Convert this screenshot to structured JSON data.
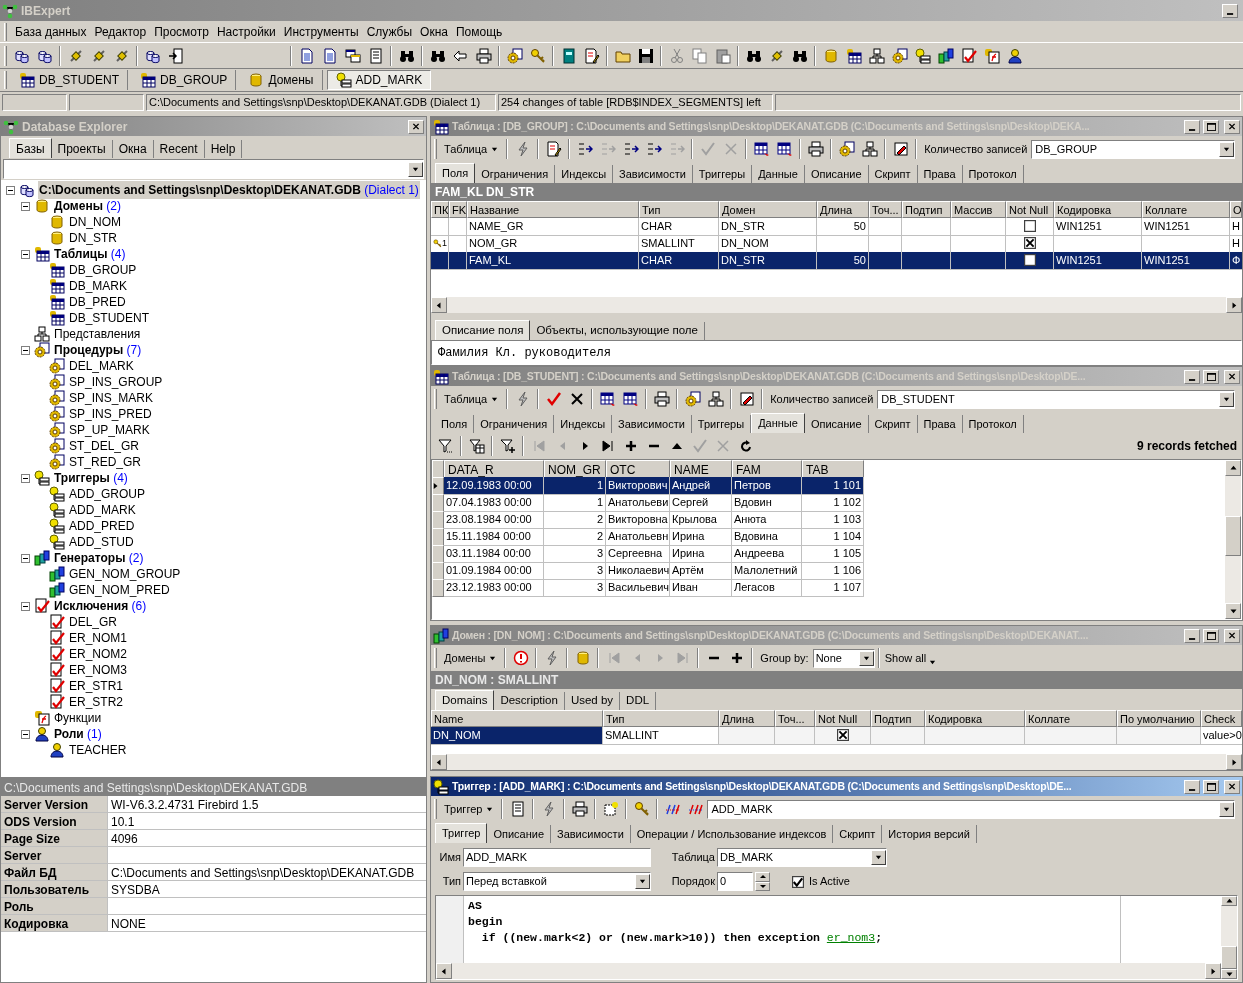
{
  "app": {
    "title": "IBExpert"
  },
  "menu": [
    "База данных",
    "Редактор",
    "Просмотр",
    "Настройки",
    "Инструменты",
    "Службы",
    "Окна",
    "Помощь"
  ],
  "window_tabs": [
    {
      "label": "DB_STUDENT",
      "kind": "table",
      "selected": false
    },
    {
      "label": "DB_GROUP",
      "kind": "table",
      "selected": false
    },
    {
      "label": "Домены",
      "kind": "domain",
      "selected": false
    },
    {
      "label": "ADD_MARK",
      "kind": "trigger",
      "selected": true
    }
  ],
  "status_bar": [
    "C:\\Documents and Settings\\snp\\Desktop\\DEKANAT.GDB (Dialect 1)",
    "254 changes of table [RDB$INDEX_SEGMENTS] left"
  ],
  "explorer": {
    "title": "Database Explorer",
    "tabs": [
      {
        "label": "Базы",
        "selected": true
      },
      {
        "label": "Проекты",
        "selected": false
      },
      {
        "label": "Окна",
        "selected": false
      },
      {
        "label": "Recent",
        "selected": false
      },
      {
        "label": "Help",
        "selected": false
      }
    ],
    "tree": [
      {
        "label": "C:\\Documents and Settings\\snp\\Desktop\\DEKANAT.GDB",
        "count": "(Dialect 1)",
        "kind": "database",
        "expanded": true,
        "selected": true,
        "children": [
          {
            "label": "Домены",
            "count": "(2)",
            "kind": "domain",
            "expanded": true,
            "selected": false,
            "children": [
              {
                "label": "DN_NOM",
                "kind": "domain",
                "selected": false
              },
              {
                "label": "DN_STR",
                "kind": "domain",
                "selected": false
              }
            ]
          },
          {
            "label": "Таблицы",
            "count": "(4)",
            "kind": "table",
            "expanded": true,
            "selected": false,
            "children": [
              {
                "label": "DB_GROUP",
                "kind": "table",
                "selected": false
              },
              {
                "label": "DB_MARK",
                "kind": "table",
                "selected": false
              },
              {
                "label": "DB_PRED",
                "kind": "table",
                "selected": false
              },
              {
                "label": "DB_STUDENT",
                "kind": "table",
                "selected": false
              }
            ]
          },
          {
            "label": "Представления",
            "kind": "view",
            "selected": false
          },
          {
            "label": "Процедуры",
            "count": "(7)",
            "kind": "procedure",
            "expanded": true,
            "selected": false,
            "children": [
              {
                "label": "DEL_MARK",
                "kind": "procedure",
                "selected": false
              },
              {
                "label": "SP_INS_GROUP",
                "kind": "procedure",
                "selected": false
              },
              {
                "label": "SP_INS_MARK",
                "kind": "procedure",
                "selected": false
              },
              {
                "label": "SP_INS_PRED",
                "kind": "procedure",
                "selected": false
              },
              {
                "label": "SP_UP_MARK",
                "kind": "procedure",
                "selected": false
              },
              {
                "label": "ST_DEL_GR",
                "kind": "procedure",
                "selected": false
              },
              {
                "label": "ST_RED_GR",
                "kind": "procedure",
                "selected": false
              }
            ]
          },
          {
            "label": "Триггеры",
            "count": "(4)",
            "kind": "trigger",
            "expanded": true,
            "selected": false,
            "children": [
              {
                "label": "ADD_GROUP",
                "kind": "trigger",
                "selected": false
              },
              {
                "label": "ADD_MARK",
                "kind": "trigger",
                "selected": false
              },
              {
                "label": "ADD_PRED",
                "kind": "trigger",
                "selected": false
              },
              {
                "label": "ADD_STUD",
                "kind": "trigger",
                "selected": false
              }
            ]
          },
          {
            "label": "Генераторы",
            "count": "(2)",
            "kind": "generator",
            "expanded": true,
            "selected": false,
            "children": [
              {
                "label": "GEN_NOM_GROUP",
                "kind": "generator",
                "selected": false
              },
              {
                "label": "GEN_NOM_PRED",
                "kind": "generator",
                "selected": false
              }
            ]
          },
          {
            "label": "Исключения",
            "count": "(6)",
            "kind": "exception",
            "expanded": true,
            "selected": false,
            "children": [
              {
                "label": "DEL_GR",
                "kind": "exception",
                "selected": false
              },
              {
                "label": "ER_NOM1",
                "kind": "exception",
                "selected": false
              },
              {
                "label": "ER_NOM2",
                "kind": "exception",
                "selected": false
              },
              {
                "label": "ER_NOM3",
                "kind": "exception",
                "selected": false
              },
              {
                "label": "ER_STR1",
                "kind": "exception",
                "selected": false
              },
              {
                "label": "ER_STR2",
                "kind": "exception",
                "selected": false
              }
            ]
          },
          {
            "label": "Функции",
            "kind": "function",
            "selected": false
          },
          {
            "label": "Роли",
            "count": "(1)",
            "kind": "role",
            "expanded": true,
            "selected": false,
            "children": [
              {
                "label": "TEACHER",
                "kind": "role",
                "selected": false
              }
            ]
          }
        ]
      }
    ],
    "properties": {
      "header": "C:\\Documents and Settings\\snp\\Desktop\\DEKANAT.GDB",
      "rows": [
        {
          "name": "Server Version",
          "value": "WI-V6.3.2.4731 Firebird 1.5"
        },
        {
          "name": "ODS Version",
          "value": "10.1"
        },
        {
          "name": "Page Size",
          "value": "4096"
        },
        {
          "name": "Server",
          "value": ""
        },
        {
          "name": "Файл БД",
          "value": "C:\\Documents and Settings\\snp\\Desktop\\DEKANAT.GDB"
        },
        {
          "name": "Пользователь",
          "value": "SYSDBA"
        },
        {
          "name": "Роль",
          "value": ""
        },
        {
          "name": "Кодировка",
          "value": "NONE"
        }
      ]
    }
  },
  "table_window": {
    "title": "Таблица : [DB_GROUP] : C:\\Documents and Settings\\snp\\Desktop\\DEKANAT.GDB (C:\\Documents and Settings\\snp\\Desktop\\DEKA...",
    "active": false,
    "menu_button": "Таблица",
    "records_label": "Количество записей",
    "object": "DB_GROUP",
    "tabs": [
      {
        "label": "Поля",
        "selected": true
      },
      {
        "label": "Ограничения",
        "selected": false
      },
      {
        "label": "Индексы",
        "selected": false
      },
      {
        "label": "Зависимости",
        "selected": false
      },
      {
        "label": "Триггеры",
        "selected": false
      },
      {
        "label": "Данные",
        "selected": false
      },
      {
        "label": "Описание",
        "selected": false
      },
      {
        "label": "Скрипт",
        "selected": false
      },
      {
        "label": "Права",
        "selected": false
      },
      {
        "label": "Протокол",
        "selected": false
      }
    ],
    "caption": "FAM_KL DN_STR",
    "columns": [
      "ПК",
      "FK",
      "Название",
      "Тип",
      "Домен",
      "Длина",
      "Точ...",
      "Подтип",
      "Массив",
      "Not Null",
      "Кодировка",
      "Коллате",
      "О"
    ],
    "rows": [
      {
        "name": "NAME_GR",
        "type": "CHAR",
        "domain": "DN_STR",
        "length": "50",
        "not_null": false,
        "charset": "WIN1251",
        "collate": "WIN1251",
        "column_13": "Н",
        "selected": false
      },
      {
        "key": "1",
        "name": "NOM_GR",
        "type": "SMALLINT",
        "domain": "DN_NOM",
        "not_null": true,
        "column_13": "Н",
        "selected": false
      },
      {
        "name": "FAM_KL",
        "type": "CHAR",
        "domain": "DN_STR",
        "length": "50",
        "not_null": false,
        "charset": "WIN1251",
        "collate": "WIN1251",
        "column_13": "Ф",
        "selected": true
      }
    ],
    "bottom_tabs": [
      {
        "label": "Описание поля",
        "selected": true
      },
      {
        "label": "Объекты, использующие поле",
        "selected": false
      }
    ],
    "description": "Фамилия Кл. руководителя"
  },
  "student_window": {
    "title": "Таблица : [DB_STUDENT] : C:\\Documents and Settings\\snp\\Desktop\\DEKANAT.GDB (C:\\Documents and Settings\\snp\\Desktop\\DE...",
    "active": false,
    "menu_button": "Таблица",
    "records_label": "Количество записей",
    "object": "DB_STUDENT",
    "tabs": [
      {
        "label": "Поля",
        "selected": false
      },
      {
        "label": "Ограничения",
        "selected": false
      },
      {
        "label": "Индексы",
        "selected": false
      },
      {
        "label": "Зависимости",
        "selected": false
      },
      {
        "label": "Триггеры",
        "selected": false
      },
      {
        "label": "Данные",
        "selected": true
      },
      {
        "label": "Описание",
        "selected": false
      },
      {
        "label": "Скрипт",
        "selected": false
      },
      {
        "label": "Права",
        "selected": false
      },
      {
        "label": "Протокол",
        "selected": false
      }
    ],
    "fetched": "9 records fetched",
    "columns": [
      "DATA_R",
      "NOM_GR",
      "OTC",
      "NAME",
      "FAM",
      "TAB"
    ],
    "rows": [
      {
        "cells": [
          "12.09.1983 00:00",
          "1",
          "Викторович",
          "Андрей",
          "Петров",
          "1 101"
        ],
        "selected": true
      },
      {
        "cells": [
          "07.04.1983 00:00",
          "1",
          "Анатольеви",
          "Сергей",
          "Вдовин",
          "1 102"
        ],
        "selected": false
      },
      {
        "cells": [
          "23.08.1984 00:00",
          "2",
          "Викторовна",
          "Крылова",
          "Анюта",
          "1 103"
        ],
        "selected": false
      },
      {
        "cells": [
          "15.11.1984 00:00",
          "2",
          "Анатольевн",
          "Ирина",
          "Вдовина",
          "1 104"
        ],
        "selected": false
      },
      {
        "cells": [
          "03.11.1984 00:00",
          "3",
          "Сергеевна",
          "Ирина",
          "Андреева",
          "1 105"
        ],
        "selected": false
      },
      {
        "cells": [
          "01.09.1984 00:00",
          "3",
          "Николаевич",
          "Артём",
          "Малолетний",
          "1 106"
        ],
        "selected": false
      },
      {
        "cells": [
          "23.12.1983 00:00",
          "3",
          "Васильевич",
          "Иван",
          "Легасов",
          "1 107"
        ],
        "selected": false
      }
    ]
  },
  "domain_window": {
    "title": "Домен : [DN_NOM] : C:\\Documents and Settings\\snp\\Desktop\\DEKANAT.GDB (C:\\Documents and Settings\\snp\\Desktop\\DEKANAT....",
    "active": false,
    "menu_button": "Домены",
    "group_by_label": "Group by:",
    "group_by": "None",
    "show_all": "Show all",
    "caption": "DN_NOM : SMALLINT",
    "tabs": [
      {
        "label": "Domains",
        "selected": true
      },
      {
        "label": "Description",
        "selected": false
      },
      {
        "label": "Used by",
        "selected": false
      },
      {
        "label": "DDL",
        "selected": false
      }
    ],
    "columns": [
      "Name",
      "Тип",
      "Длина",
      "Точ...",
      "Not Null",
      "Подтип",
      "Кодировка",
      "Коллате",
      "По умолчанию",
      "Check"
    ],
    "rows": [
      {
        "name": "DN_NOM",
        "type": "SMALLINT",
        "not_null": true,
        "check": "value>0",
        "selected": true
      }
    ]
  },
  "trigger_window": {
    "title": "Триггер : [ADD_MARK] : C:\\Documents and Settings\\snp\\Desktop\\DEKANAT.GDB (C:\\Documents and Settings\\snp\\Desktop\\DE...",
    "active": true,
    "menu_button": "Триггер",
    "object": "ADD_MARK",
    "tabs": [
      {
        "label": "Триггер",
        "selected": true
      },
      {
        "label": "Описание",
        "selected": false
      },
      {
        "label": "Зависимости",
        "selected": false
      },
      {
        "label": "Операции / Использование индексов",
        "selected": false
      },
      {
        "label": "Скрипт",
        "selected": false
      },
      {
        "label": "История версий",
        "selected": false
      }
    ],
    "name_label": "Имя",
    "name": "ADD_MARK",
    "table_label": "Таблица",
    "table": "DB_MARK",
    "type_label": "Тип",
    "type": "Перед вставкой",
    "order_label": "Порядок",
    "order": "0",
    "active_label": "Is Active",
    "is_active": true,
    "code": [
      [
        {
          "text": "AS"
        }
      ],
      [
        {
          "text": "begin"
        }
      ],
      [
        {
          "text": "  if ((new.mark<2) or (new.mark>10)) then exception "
        },
        {
          "text": "er_nom3",
          "kind": "link"
        },
        {
          "text": ";"
        }
      ]
    ]
  }
}
